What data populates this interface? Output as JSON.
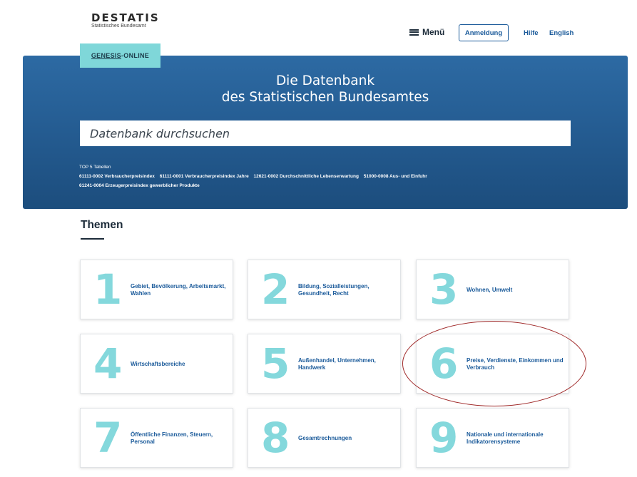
{
  "header": {
    "logo_word": "DESTATIS",
    "logo_sub": "Statistisches Bundesamt",
    "menu_label": "Menü",
    "login_label": "Anmeldung",
    "help_label": "Hilfe",
    "english_label": "English"
  },
  "genesis_tab": {
    "part1": "GENESIS",
    "part2": "-ONLINE"
  },
  "hero": {
    "title_line1": "Die Datenbank",
    "title_line2": "des Statistischen Bundesamtes",
    "search_placeholder": "Datenbank durchsuchen",
    "top5_title": "TOP 5 Tabellen",
    "top5_items": [
      "61111-0002 Verbraucherpreisindex",
      "61111-0001 Verbraucherpreisindex Jahre",
      "12621-0002 Durchschnittliche Lebenserwartung",
      "51000-0008 Aus- und Einfuhr",
      "61241-0004 Erzeugerpreisindex gewerblicher Produkte"
    ]
  },
  "themen": {
    "title": "Themen",
    "tiles": [
      {
        "num": "1",
        "label": "Gebiet, Bevölkerung, Arbeitsmarkt, Wahlen"
      },
      {
        "num": "2",
        "label": "Bildung, Sozialleistungen, Gesundheit, Recht"
      },
      {
        "num": "3",
        "label": "Wohnen, Umwelt"
      },
      {
        "num": "4",
        "label": "Wirtschaftsbereiche"
      },
      {
        "num": "5",
        "label": "Außenhandel, Unternehmen, Handwerk"
      },
      {
        "num": "6",
        "label": "Preise, Verdienste, Einkommen und Verbrauch"
      },
      {
        "num": "7",
        "label": "Öffentliche Finanzen, Steuern, Personal"
      },
      {
        "num": "8",
        "label": "Gesamtrechnungen"
      },
      {
        "num": "9",
        "label": "Nationale und internationale Indikatorensysteme"
      }
    ]
  },
  "colors": {
    "hero_blue": "#255d93",
    "accent_teal": "#7fd7d9",
    "link_blue": "#1a5a9a",
    "highlight_red": "#a02a2a"
  }
}
